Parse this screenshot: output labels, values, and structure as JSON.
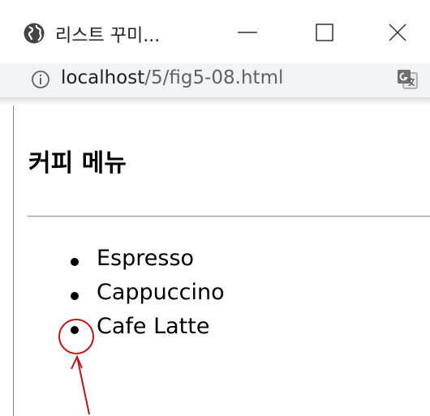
{
  "window": {
    "tab_title": "리스트 꾸미...",
    "icons": {
      "tab": "globe-icon",
      "minimize": "minimize-icon",
      "maximize": "maximize-icon",
      "close": "close-icon"
    }
  },
  "address_bar": {
    "info_icon": "info-icon",
    "url_host": "localhost",
    "url_path": "/5/fig5-08.html",
    "translate_icon": "translate-icon"
  },
  "page": {
    "heading": "커피 메뉴",
    "list_items": [
      "Espresso",
      "Cappuccino",
      "Cafe Latte"
    ]
  },
  "annotation": {
    "color": "#c0141a",
    "target": "bullet of Cafe Latte"
  },
  "colors": {
    "address_bar_bg": "#f1f3f4",
    "annotation": "#c0141a"
  }
}
